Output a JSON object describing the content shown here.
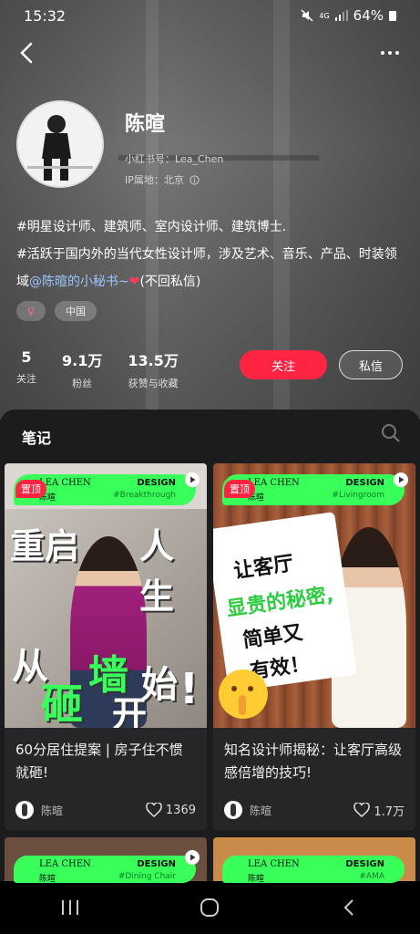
{
  "status_bar": {
    "time": "15:32",
    "network": "4G",
    "battery": "64%"
  },
  "profile": {
    "name": "陈暄",
    "account_id": "小红书号：Lea_Chen",
    "ip_location": "IP属地：北京",
    "bio_line1": "#明星设计师、建筑师、室内设计师、建筑博士.",
    "bio_line2_prefix": "#活跃于国内外的当代女性设计师，涉及艺术、音乐、产品、时装领域",
    "bio_mention": "@陈暄的小秘书~",
    "bio_suffix": "(不回私信)",
    "gender_tag": "♀",
    "region_tag": "中国"
  },
  "stats": [
    {
      "value": "5",
      "label": "关注"
    },
    {
      "value": "9.1万",
      "label": "粉丝"
    },
    {
      "value": "13.5万",
      "label": "获赞与收藏"
    }
  ],
  "actions": {
    "follow": "关注",
    "message": "私信"
  },
  "notes_section": {
    "title": "笔记"
  },
  "cards": [
    {
      "pin": "置顶",
      "brand_left": "LEA CHEN",
      "brand_left_sub": "陈暄",
      "brand_right": "DESIGN",
      "brand_right_sub": "#Breakthrough",
      "cover_line1a": "重启",
      "cover_line1b": "人生",
      "cover_line2": "从",
      "cover_line3a": "砸",
      "cover_line3b": "墙",
      "cover_line3c": "始",
      "cover_line4": "开",
      "title": "60分居住提案 | 房子住不惯就砸!",
      "author": "陈暄",
      "likes": "1369"
    },
    {
      "pin": "置顶",
      "brand_left": "LEA CHEN",
      "brand_left_sub": "陈暄",
      "brand_right": "DESIGN",
      "brand_right_sub": "#Livingroom",
      "cover_line1": "让客厅",
      "cover_line2": "显贵的秘密,",
      "cover_line3": "简单又",
      "cover_line4": "有效！",
      "title": "知名设计师揭秘：让客厅高级感倍增的技巧!",
      "author": "陈暄",
      "likes": "1.7万"
    }
  ],
  "peek_cards": [
    {
      "brand_left": "LEA CHEN",
      "brand_left_sub": "陈暄",
      "brand_right": "DESIGN",
      "brand_right_sub": "#Dining Chair"
    },
    {
      "brand_left": "LEA CHEN",
      "brand_left_sub": "陈暄",
      "brand_right": "DESIGN",
      "brand_right_sub": "#AMA"
    }
  ],
  "colors": {
    "accent_red": "#ff2442",
    "brand_green": "#39ff5a"
  }
}
